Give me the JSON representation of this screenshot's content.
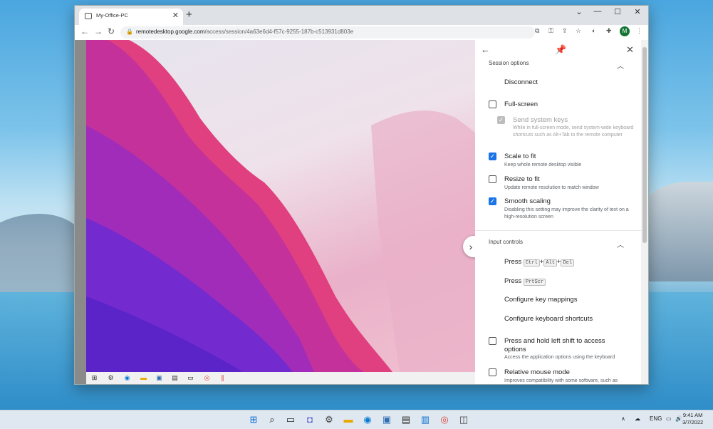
{
  "browser": {
    "tab_title": "My-Office-PC",
    "tab_close": "✕",
    "new_tab": "+",
    "url_domain": "remotedesktop.google.com",
    "url_path": "/access/session/4a63e6d4-f57c-9255-187b-c513931d803e",
    "avatar_letter": "M",
    "window_controls": {
      "chevron": "⌄",
      "minimize": "—",
      "maximize": "☐",
      "close": "✕"
    }
  },
  "panel": {
    "session_options": {
      "title": "Session options",
      "disconnect": "Disconnect",
      "full_screen": {
        "label": "Full-screen",
        "checked": false
      },
      "send_system_keys": {
        "label": "Send system keys",
        "desc": "While in full-screen mode, send system-wide keyboard shortcuts such as Alt+Tab to the remote computer",
        "checked": true,
        "disabled": true
      },
      "scale_to_fit": {
        "label": "Scale to fit",
        "desc": "Keep whole remote desktop visible",
        "checked": true
      },
      "resize_to_fit": {
        "label": "Resize to fit",
        "desc": "Update remote resolution to match window",
        "checked": false
      },
      "smooth_scaling": {
        "label": "Smooth scaling",
        "desc": "Disabling this setting may improve the clarity of text on a high-resolution screen",
        "checked": true
      }
    },
    "input_controls": {
      "title": "Input controls",
      "press_label": "Press",
      "keys_ctrl": "Ctrl",
      "keys_alt": "Alt",
      "keys_del": "Del",
      "plus": "+",
      "key_prtscr": "PrtScr",
      "configure_key_mappings": "Configure key mappings",
      "configure_keyboard_shortcuts": "Configure keyboard shortcuts",
      "press_hold_shift": {
        "label": "Press and hold left shift to access options",
        "desc": "Access the application options using the keyboard",
        "checked": false
      },
      "relative_mouse": {
        "label": "Relative mouse mode",
        "desc": "Improves compatibility with some software, such as",
        "checked": false
      }
    }
  },
  "taskbar": {
    "language": "ENG",
    "time": "9:41 AM",
    "date": "3/7/2022"
  },
  "colors": {
    "accent": "#1a73e8",
    "avatar": "#137333"
  }
}
